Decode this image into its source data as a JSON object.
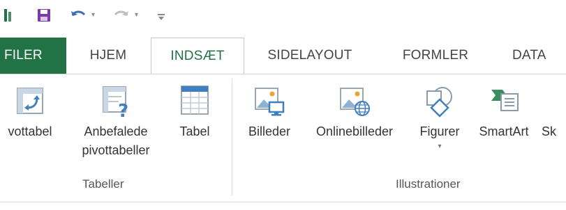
{
  "quick_access": {
    "items": [
      {
        "name": "excel-app-icon"
      },
      {
        "name": "save-icon"
      },
      {
        "name": "undo-icon"
      },
      {
        "name": "redo-icon"
      },
      {
        "name": "customize-qat-icon"
      }
    ]
  },
  "tabs": {
    "file": "FILER",
    "home": "HJEM",
    "insert": "INDSÆT",
    "page_layout": "SIDELAYOUT",
    "formulas": "FORMLER",
    "data": "DATA"
  },
  "active_tab": "INDSÆT",
  "ribbon": {
    "groups": [
      {
        "label": "Tabeller",
        "buttons": [
          {
            "label": "vottabel",
            "icon": "pivottable-icon"
          },
          {
            "label": "Anbefalede",
            "label2": "pivottabeller",
            "icon": "recommended-pivot-icon"
          },
          {
            "label": "Tabel",
            "icon": "table-icon"
          }
        ]
      },
      {
        "label": "Illustrationer",
        "buttons": [
          {
            "label": "Billeder",
            "icon": "pictures-icon"
          },
          {
            "label": "Onlinebilleder",
            "icon": "online-pictures-icon"
          },
          {
            "label": "Figurer",
            "icon": "shapes-icon",
            "dropdown": "▾"
          },
          {
            "label": "SmartArt",
            "icon": "smartart-icon"
          },
          {
            "label": "Sk",
            "icon": "screenshot-icon"
          }
        ]
      }
    ]
  },
  "colors": {
    "file_tab": "#217346",
    "active_tab_text": "#217346",
    "icon_blue": "#3f7fbf",
    "icon_orange": "#e8a33a",
    "icon_green": "#3b8f5f"
  }
}
